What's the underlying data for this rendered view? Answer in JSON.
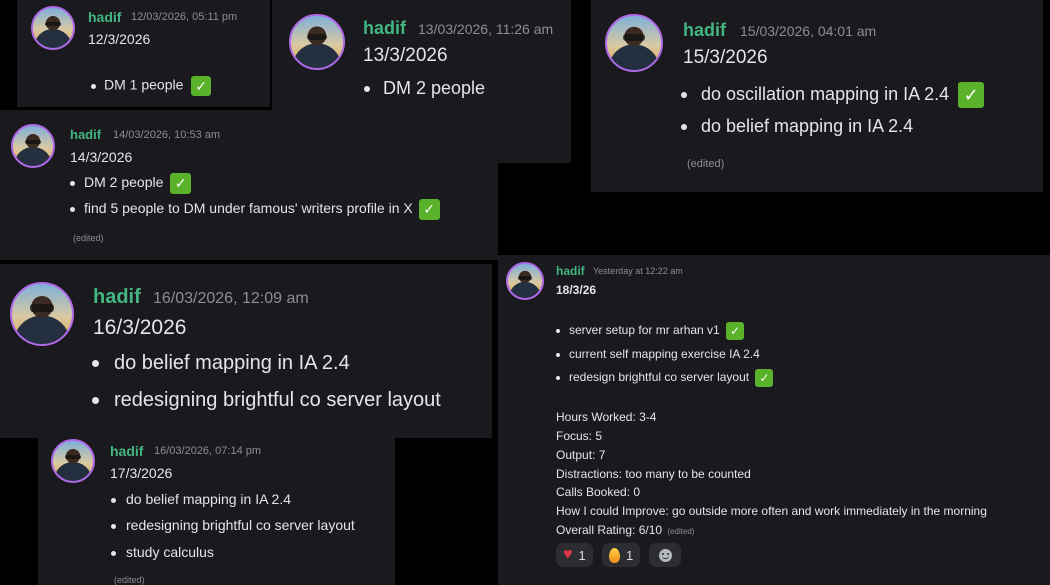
{
  "messages": [
    {
      "author": "hadif",
      "timestamp": "12/03/2026, 05:11 pm",
      "date": "12/3/2026",
      "items": [
        {
          "text": "DM 1 people",
          "check": true
        }
      ]
    },
    {
      "author": "hadif",
      "timestamp": "13/03/2026, 11:26 am",
      "date": "13/3/2026",
      "items": [
        {
          "text": "DM 2 people",
          "check": false
        }
      ]
    },
    {
      "author": "hadif",
      "timestamp": "15/03/2026, 04:01 am",
      "date": "15/3/2026",
      "items": [
        {
          "text": "do oscillation mapping in IA 2.4",
          "check": true
        },
        {
          "text": "do belief mapping in IA 2.4",
          "check": false
        }
      ],
      "edited": "(edited)"
    },
    {
      "author": "hadif",
      "timestamp": "14/03/2026, 10:53 am",
      "date": "14/3/2026",
      "items": [
        {
          "text": "DM 2 people",
          "check": true
        },
        {
          "text": "find 5 people to DM under famous' writers profile in X",
          "check": true
        }
      ],
      "edited": "(edited)"
    },
    {
      "author": "hadif",
      "timestamp": "16/03/2026, 12:09 am",
      "date": "16/3/2026",
      "items": [
        {
          "text": "do belief mapping in IA 2.4",
          "check": false
        },
        {
          "text": "redesigning brightful co server layout",
          "check": false
        }
      ]
    },
    {
      "author": "hadif",
      "timestamp": "16/03/2026, 07:14 pm",
      "date": "17/3/2026",
      "items": [
        {
          "text": "do belief mapping in IA 2.4",
          "check": false
        },
        {
          "text": "redesigning brightful co server layout",
          "check": false
        },
        {
          "text": "study calculus",
          "check": false
        }
      ],
      "edited": "(edited)"
    },
    {
      "author": "hadif",
      "timestamp": "Yesterday at 12:22 am",
      "date": "18/3/26",
      "items": [
        {
          "text": "server setup for mr arhan v1",
          "check": true
        },
        {
          "text": "current self mapping exercise IA 2.4",
          "check": false
        },
        {
          "text": "redesign brightful co server layout",
          "check": true
        }
      ],
      "stats": [
        "Hours Worked: 3-4",
        "Focus: 5",
        "Output: 7",
        "Distractions: too many to be counted",
        "Calls Booked: 0",
        "How I could Improve: go outside more often and work immediately in the morning",
        "Overall Rating: 6/10"
      ],
      "edited": "(edited)",
      "reactions": [
        {
          "icon": "heart-icon",
          "count": "1"
        },
        {
          "icon": "fire-icon",
          "count": "1"
        },
        {
          "icon": "add-reaction-icon",
          "count": ""
        }
      ]
    }
  ],
  "check_glyph": "✓",
  "colors": {
    "username": "#43b581",
    "card_bg": "#1a1a1e",
    "check_bg": "#59b22a",
    "timestamp": "#8a8e94"
  }
}
